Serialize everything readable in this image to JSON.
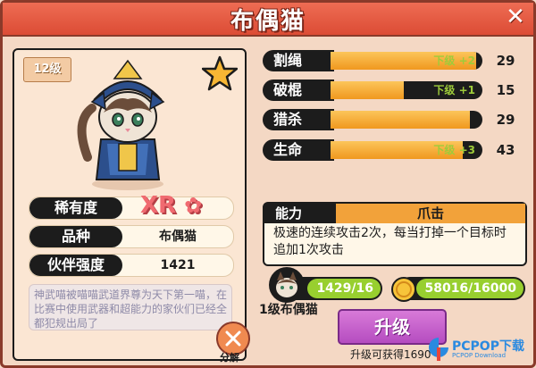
{
  "title": "布偶猫",
  "pet": {
    "level_badge": "12级",
    "rarity_label": "稀有度",
    "rarity_value": "XR",
    "breed_label": "品种",
    "breed_value": "布偶猫",
    "power_label": "伙伴强度",
    "power_value": "1421",
    "description": "神武喵被喵喵武道界尊为天下第一喵，在比赛中使用武器和超能力的家伙们已经全都犯规出局了",
    "decompose_label": "分解"
  },
  "attributes": [
    {
      "name": "割绳",
      "bonus": "下级 +2",
      "value": "29",
      "fill": 0.96
    },
    {
      "name": "破棍",
      "bonus": "下级 +1",
      "value": "15",
      "fill": 0.48
    },
    {
      "name": "猎杀",
      "bonus": "",
      "value": "29",
      "fill": 0.92
    },
    {
      "name": "生命",
      "bonus": "下级 +3",
      "value": "43",
      "fill": 0.87
    }
  ],
  "ability": {
    "label": "能力",
    "name": "爪击",
    "description": "极速的连续攻击2次，每当打掉一个目标时追加1次攻击"
  },
  "resources": {
    "pet_progress": "1429/16",
    "pet_caption": "1级布偶猫",
    "coins": "58016/16000"
  },
  "upgrade": {
    "button_label": "升级",
    "note": "升级可获得1690"
  },
  "watermark": {
    "text": "PCPOP下载",
    "sub": "PCPOP Download"
  },
  "colors": {
    "frame_red": "#dc4c35",
    "bar_orange": "#f0981e",
    "resource_green": "#98cf2f",
    "upgrade_purple": "#b54cc0"
  }
}
